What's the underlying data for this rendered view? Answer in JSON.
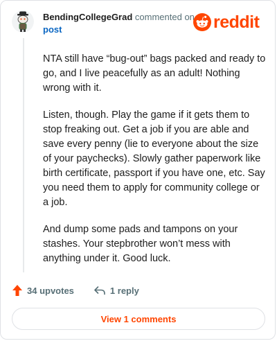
{
  "comment": {
    "username": "BendingCollegeGrad",
    "action": "commented on",
    "post_link": "post",
    "avatar_icon": "snoo-avatar-icon",
    "paragraphs": [
      "NTA still have “bug-out” bags packed and ready to go, and I live peacefully as an adult! Nothing wrong with it.",
      "Listen, though. Play the game if it gets them to stop freaking out. Get a job if you are able and save every penny (lie to everyone about the size of your paychecks). Slowly gather paperwork like birth certificate, passport if you have one, etc. Say you need them to apply for community college or a job.",
      "And dump some pads and tampons on your stashes. Your stepbrother won’t mess with anything under it. Good luck."
    ]
  },
  "brand": {
    "wordmark": "reddit",
    "color": "#ff4500"
  },
  "actions": {
    "upvotes": "34 upvotes",
    "replies": "1 reply",
    "upvote_icon": "upvote-arrow-icon",
    "reply_icon": "reply-arrow-icon"
  },
  "view_comments": "View 1 comments",
  "colors": {
    "accent": "#ff4500",
    "link": "#0a66c2",
    "muted": "#576f76",
    "border": "#dfe1e5"
  }
}
